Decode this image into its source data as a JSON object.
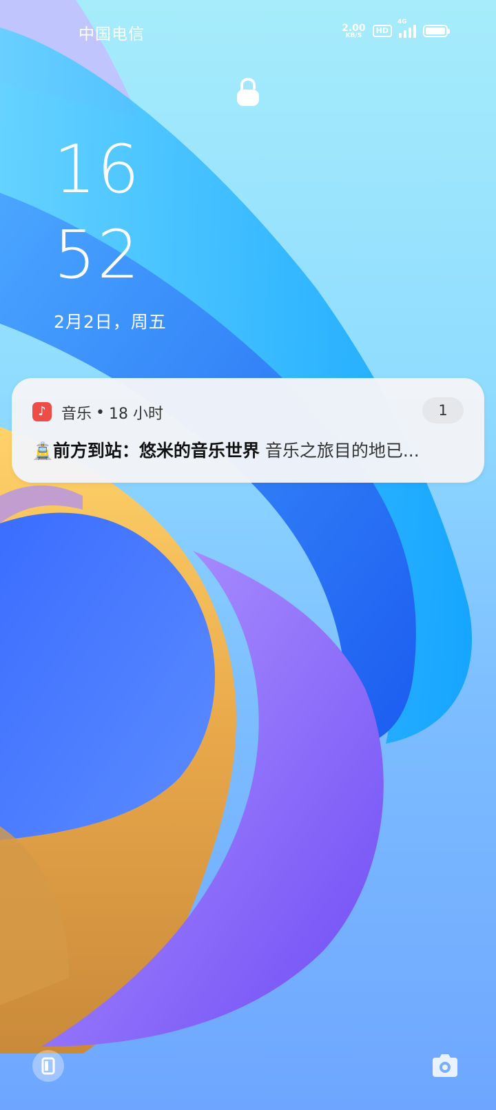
{
  "status_bar": {
    "carrier": "中国电信",
    "net_speed_value": "2.00",
    "net_speed_unit": "KB/S",
    "hd_label": "HD",
    "network_type": "4G",
    "signal_icon": "signal-bars-icon",
    "battery_icon": "battery-full-icon"
  },
  "lock_screen": {
    "lock_icon": "padlock-icon",
    "hour": "16",
    "minute": "52",
    "date": "2月2日，周五"
  },
  "notification": {
    "app_icon": "music-note-icon",
    "app_name": "音乐",
    "separator": "•",
    "time": "18 小时",
    "count": "1",
    "emoji": "🚊",
    "title": "前方到站：悠米的音乐世界",
    "text": "音乐之旅目的地已..."
  },
  "shortcuts": {
    "left_icon": "wallet-icon",
    "right_icon": "camera-icon"
  },
  "colors": {
    "notification_bg": "#f3f4f8",
    "app_icon_bg": "#ee4d47",
    "count_badge_bg": "#e6e7eb"
  }
}
